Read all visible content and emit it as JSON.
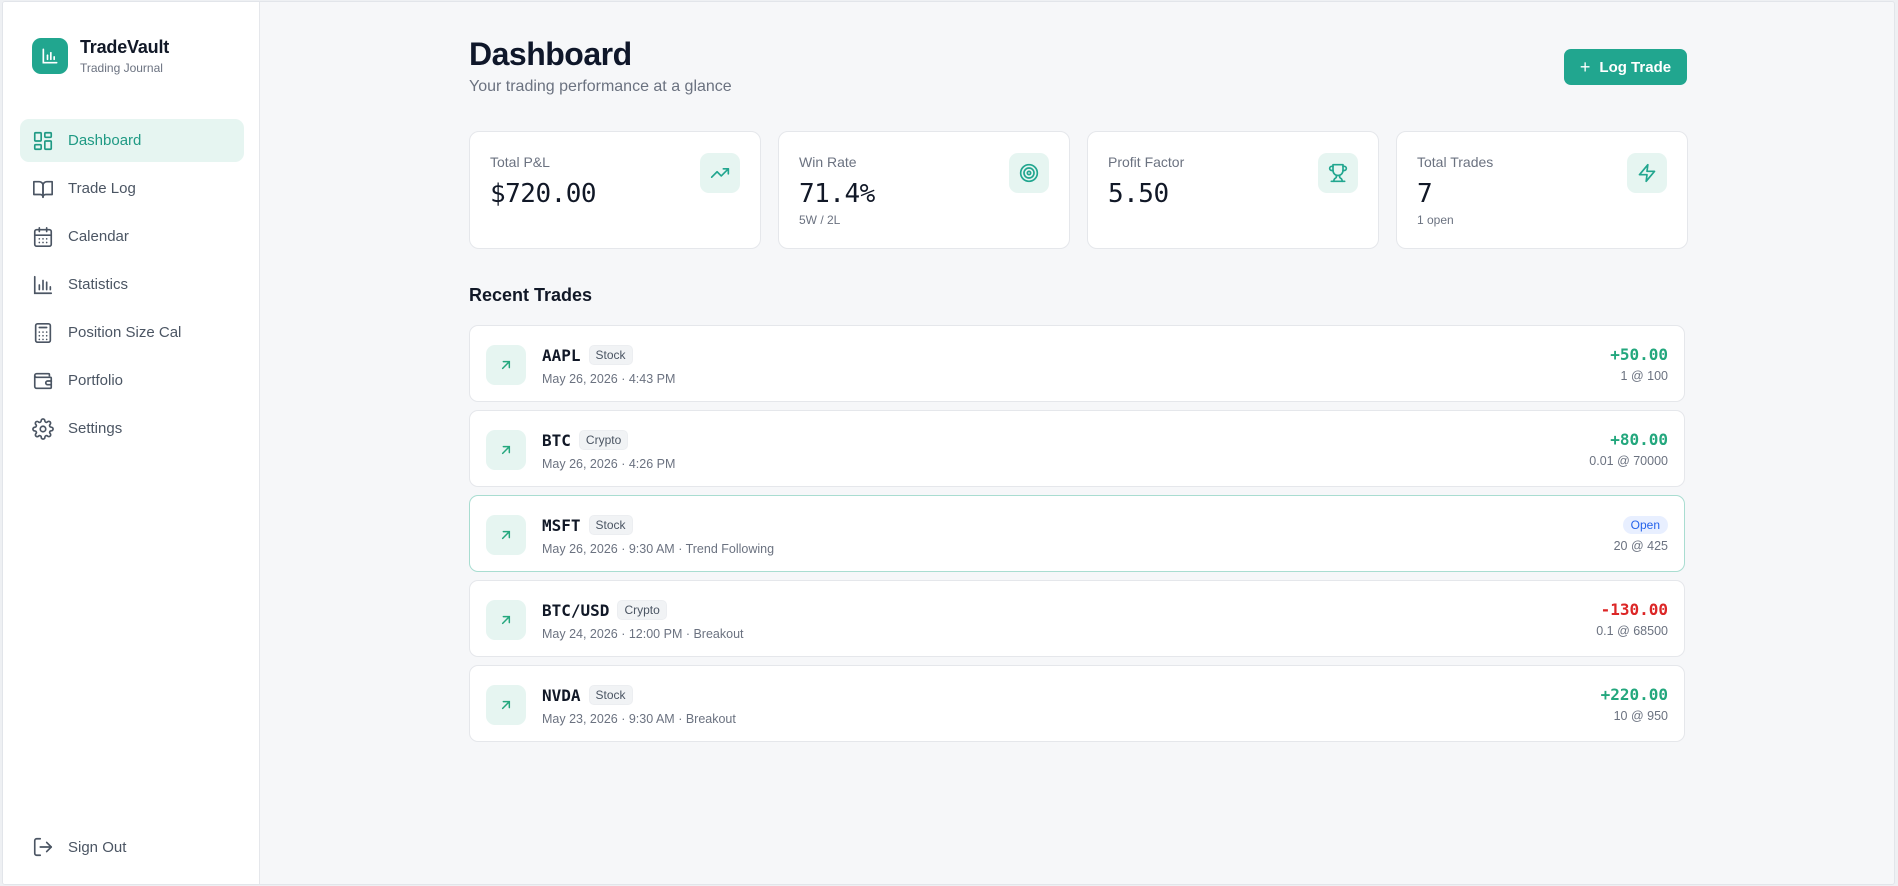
{
  "brand": {
    "name": "TradeVault",
    "subtitle": "Trading Journal"
  },
  "sidebar": {
    "items": [
      {
        "label": "Dashboard",
        "icon": "dashboard-icon",
        "active": true
      },
      {
        "label": "Trade Log",
        "icon": "book-icon"
      },
      {
        "label": "Calendar",
        "icon": "calendar-icon"
      },
      {
        "label": "Statistics",
        "icon": "bar-chart-icon"
      },
      {
        "label": "Position Size Cal",
        "icon": "calculator-icon"
      },
      {
        "label": "Portfolio",
        "icon": "wallet-icon"
      },
      {
        "label": "Settings",
        "icon": "gear-icon"
      }
    ],
    "sign_out": "Sign Out"
  },
  "header": {
    "title": "Dashboard",
    "subtitle": "Your trading performance at a glance",
    "log_button": "Log Trade"
  },
  "stats": [
    {
      "label": "Total P&L",
      "value": "$720.00",
      "sub": "",
      "icon": "trending-up-icon"
    },
    {
      "label": "Win Rate",
      "value": "71.4%",
      "sub": "5W / 2L",
      "icon": "target-icon"
    },
    {
      "label": "Profit Factor",
      "value": "5.50",
      "sub": "",
      "icon": "trophy-icon"
    },
    {
      "label": "Total Trades",
      "value": "7",
      "sub": "1 open",
      "icon": "lightning-icon"
    }
  ],
  "recent": {
    "title": "Recent Trades",
    "trades": [
      {
        "symbol": "AAPL",
        "type": "Stock",
        "meta": "May 26, 2026 · 4:43 PM",
        "pnl": "+50.00",
        "status": "",
        "qty": "1 @ 100"
      },
      {
        "symbol": "BTC",
        "type": "Crypto",
        "meta": "May 26, 2026 · 4:26 PM",
        "pnl": "+80.00",
        "status": "",
        "qty": "0.01 @ 70000"
      },
      {
        "symbol": "MSFT",
        "type": "Stock",
        "meta": "May 26, 2026 · 9:30 AM · Trend Following",
        "pnl": "",
        "status": "Open",
        "qty": "20 @ 425"
      },
      {
        "symbol": "BTC/USD",
        "type": "Crypto",
        "meta": "May 24, 2026 · 12:00 PM · Breakout",
        "pnl": "-130.00",
        "status": "",
        "qty": "0.1 @ 68500"
      },
      {
        "symbol": "NVDA",
        "type": "Stock",
        "meta": "May 23, 2026 · 9:30 AM · Breakout",
        "pnl": "+220.00",
        "status": "",
        "qty": "10 @ 950"
      }
    ]
  },
  "colors": {
    "accent": "#21a68f",
    "positive": "#23a77d",
    "negative": "#dc2626",
    "open": "#2563eb"
  }
}
